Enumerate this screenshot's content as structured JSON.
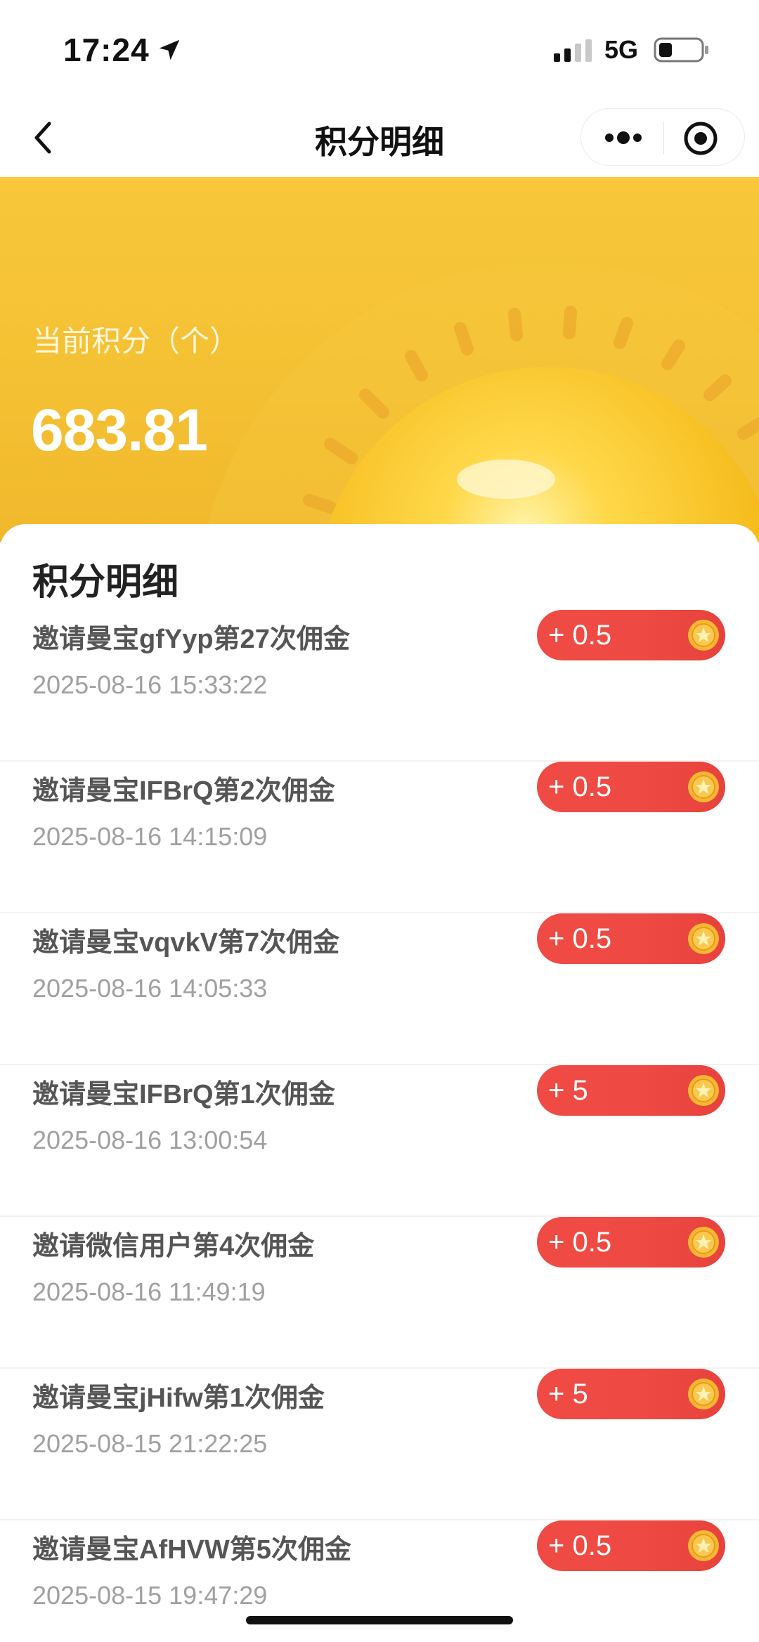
{
  "status_bar": {
    "time": "17:24",
    "network": "5G",
    "icons": [
      "location-arrow-icon",
      "signal-icon",
      "battery-icon"
    ]
  },
  "nav": {
    "title": "积分明细",
    "icons": [
      "back-icon",
      "more-icon",
      "close-target-icon"
    ]
  },
  "banner": {
    "label": "当前积分（个）",
    "value": "683.81",
    "background_color": "#f6c437"
  },
  "details": {
    "section_title": "积分明细",
    "items": [
      {
        "title": "邀请曼宝gfYyp第27次佣金",
        "date": "2025-08-16 15:33:22",
        "amount": "+ 0.5"
      },
      {
        "title": "邀请曼宝IFBrQ第2次佣金",
        "date": "2025-08-16 14:15:09",
        "amount": "+ 0.5"
      },
      {
        "title": "邀请曼宝vqvkV第7次佣金",
        "date": "2025-08-16 14:05:33",
        "amount": "+ 0.5"
      },
      {
        "title": "邀请曼宝IFBrQ第1次佣金",
        "date": "2025-08-16 13:00:54",
        "amount": "+ 5"
      },
      {
        "title": "邀请微信用户第4次佣金",
        "date": "2025-08-16 11:49:19",
        "amount": "+ 0.5"
      },
      {
        "title": "邀请曼宝jHifw第1次佣金",
        "date": "2025-08-15 21:22:25",
        "amount": "+ 5"
      },
      {
        "title": "邀请曼宝AfHVW第5次佣金",
        "date": "2025-08-15 19:47:29",
        "amount": "+ 0.5"
      }
    ],
    "pill_color": "#ee4a43",
    "coin_color": "#f7b733"
  }
}
